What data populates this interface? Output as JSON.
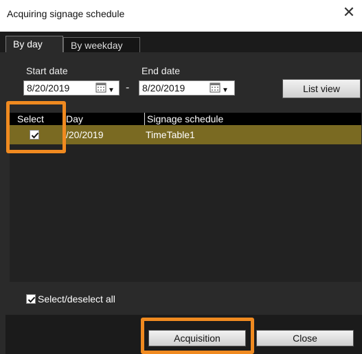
{
  "window": {
    "title": "Acquiring signage schedule"
  },
  "tabs": [
    {
      "label": "By day",
      "active": true
    },
    {
      "label": "By weekday",
      "active": false
    }
  ],
  "filters": {
    "start_date_label": "Start date",
    "start_date_value": "8/20/2019",
    "end_date_label": "End date",
    "end_date_value": "8/20/2019",
    "separator": "-",
    "list_view_label": "List view"
  },
  "table": {
    "columns": [
      "Select",
      "Day",
      "Signage schedule"
    ],
    "rows": [
      {
        "selected": true,
        "day": "/20/2019",
        "schedule": "TimeTable1"
      }
    ]
  },
  "select_all": {
    "label": "Select/deselect all",
    "checked": true
  },
  "footer": {
    "acquisition_label": "Acquisition",
    "close_label": "Close"
  },
  "colors": {
    "highlight": "#f08a20",
    "row_selected": "#7a6a22",
    "background": "#2a2a2a"
  }
}
